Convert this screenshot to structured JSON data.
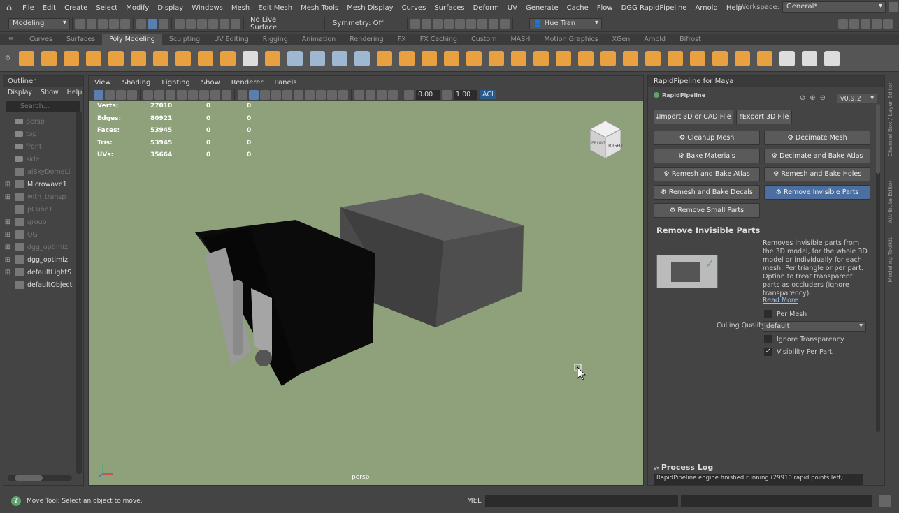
{
  "menubar": {
    "items": [
      "File",
      "Edit",
      "Create",
      "Select",
      "Modify",
      "Display",
      "Windows",
      "Mesh",
      "Edit Mesh",
      "Mesh Tools",
      "Mesh Display",
      "Curves",
      "Surfaces",
      "Deform",
      "UV",
      "Generate",
      "Cache",
      "Flow",
      "DGG RapidPipeline",
      "Arnold",
      "Help"
    ],
    "workspace_label": "Workspace:",
    "workspace_value": "General*"
  },
  "statusline": {
    "mode": "Modeling",
    "live_surface": "No Live Surface",
    "symmetry": "Symmetry: Off",
    "user": "Hue Tran"
  },
  "shelf": {
    "tabs": [
      "Curves",
      "Surfaces",
      "Poly Modeling",
      "Sculpting",
      "UV Editing",
      "Rigging",
      "Animation",
      "Rendering",
      "FX",
      "FX Caching",
      "Custom",
      "MASH",
      "Motion Graphics",
      "XGen",
      "Arnold",
      "Bifrost"
    ],
    "active_tab": "Poly Modeling"
  },
  "outliner": {
    "title": "Outliner",
    "menu": [
      "Display",
      "Show",
      "Help"
    ],
    "search_placeholder": "Search...",
    "items": [
      {
        "label": "persp",
        "dim": true,
        "expand": false,
        "icon": "camera-icon"
      },
      {
        "label": "top",
        "dim": true,
        "expand": false,
        "icon": "camera-icon"
      },
      {
        "label": "front",
        "dim": true,
        "expand": false,
        "icon": "camera-icon"
      },
      {
        "label": "side",
        "dim": true,
        "expand": false,
        "icon": "camera-icon"
      },
      {
        "label": "aiSkyDomeLi",
        "dim": true,
        "expand": false,
        "icon": "skydome-icon"
      },
      {
        "label": "Microwave1",
        "dim": false,
        "expand": true,
        "icon": "transform-icon"
      },
      {
        "label": "with_transp",
        "dim": true,
        "expand": true,
        "icon": "transform-icon"
      },
      {
        "label": "pCube1",
        "dim": true,
        "expand": false,
        "icon": "mesh-icon"
      },
      {
        "label": "group",
        "dim": true,
        "expand": true,
        "icon": "transform-icon"
      },
      {
        "label": "OG",
        "dim": true,
        "expand": true,
        "icon": "transform-icon"
      },
      {
        "label": "dgg_optimiz",
        "dim": true,
        "expand": true,
        "icon": "transform-icon"
      },
      {
        "label": "dgg_optimiz",
        "dim": false,
        "expand": true,
        "icon": "transform-icon"
      },
      {
        "label": "defaultLightS",
        "dim": false,
        "expand": true,
        "icon": "set-icon"
      },
      {
        "label": "defaultObject",
        "dim": false,
        "expand": false,
        "icon": "set-icon"
      }
    ]
  },
  "viewport": {
    "menu": [
      "View",
      "Shading",
      "Lighting",
      "Show",
      "Renderer",
      "Panels"
    ],
    "exposure": "0.00",
    "gamma": "1.00",
    "aces_label": "ACI",
    "hud": [
      {
        "k": "Verts:",
        "v": "27010",
        "a": "0",
        "b": "0"
      },
      {
        "k": "Edges:",
        "v": "80921",
        "a": "0",
        "b": "0"
      },
      {
        "k": "Faces:",
        "v": "53945",
        "a": "0",
        "b": "0"
      },
      {
        "k": "Tris:",
        "v": "53945",
        "a": "0",
        "b": "0"
      },
      {
        "k": "UVs:",
        "v": "35664",
        "a": "0",
        "b": "0"
      }
    ],
    "camera": "persp",
    "viewcube_face": "RIGHT",
    "viewcube_face2": "FRONT",
    "bg_color": "#8ea17a"
  },
  "rapid": {
    "title": "RapidPipeline for Maya",
    "logo": "RapidPipeline",
    "version": "v0.9.2",
    "import_btn": "Import 3D or CAD File",
    "export_btn": "Export 3D File",
    "buttons": [
      "Cleanup Mesh",
      "Decimate Mesh",
      "Bake Materials",
      "Decimate and Bake Atlas",
      "Remesh and Bake Atlas",
      "Remesh and Bake Holes",
      "Remesh and Bake Decals",
      "Remove Invisible Parts",
      "Remove Small Parts"
    ],
    "active_button": "Remove Invisible Parts",
    "section_title": "Remove Invisible Parts",
    "description": "Removes invisible parts from the 3D model, for the whole 3D model or individually for each mesh. Per triangle or per part. Option to treat transparent parts as occluders (ignore transparency).",
    "read_more": "Read More",
    "per_mesh": "Per Mesh",
    "culling_label": "Culling Quality",
    "culling_value": "default",
    "ignore_transparency": "Ignore Transparency",
    "visibility_per_part": "Visibility Per Part",
    "process_log_title": "Process Log",
    "process_log_text": "RapidPipeline engine finished running (29910 rapid points left)."
  },
  "sidebar_tabs": [
    "Channel Box / Layer Editor",
    "Attribute Editor",
    "Modeling Toolkit"
  ],
  "helpline": {
    "message": "Move Tool: Select an object to move.",
    "mel": "MEL"
  }
}
